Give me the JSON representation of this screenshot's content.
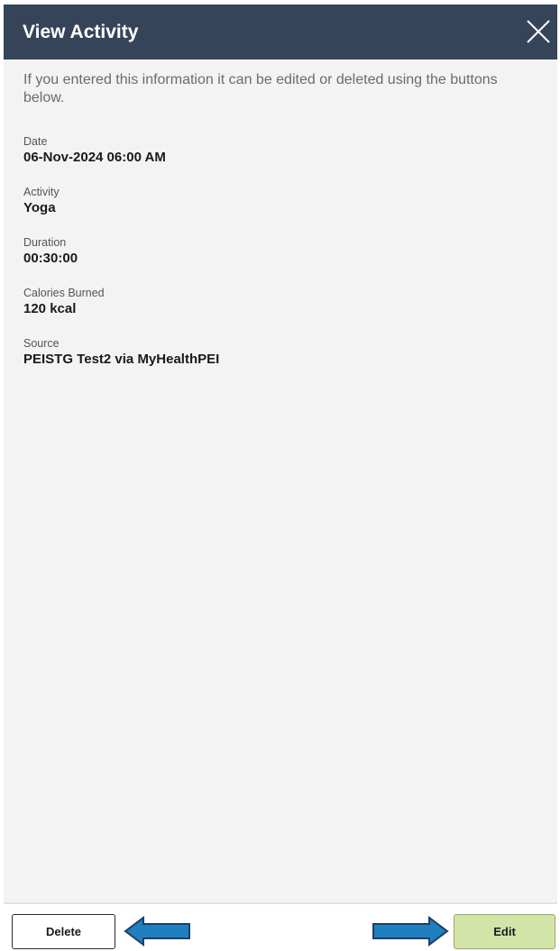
{
  "dialog": {
    "title": "View Activity",
    "close_icon": "close-x-icon",
    "intro": "If you entered this information it can be edited or deleted using the buttons below."
  },
  "fields": {
    "date": {
      "label": "Date",
      "value": "06-Nov-2024 06:00 AM"
    },
    "activity": {
      "label": "Activity",
      "value": "Yoga"
    },
    "duration": {
      "label": "Duration",
      "value": "00:30:00"
    },
    "calories": {
      "label": "Calories Burned",
      "value": "120 kcal"
    },
    "source": {
      "label": "Source",
      "value": "PEISTG Test2 via MyHealthPEI"
    }
  },
  "footer": {
    "delete_label": "Delete",
    "edit_label": "Edit"
  },
  "annotations": {
    "left_arrow_icon": "arrow-left-icon",
    "right_arrow_icon": "arrow-right-icon",
    "arrow_color": "#1f7fbf"
  },
  "colors": {
    "header_bg": "#36445a",
    "panel_bg": "#f3f3f3",
    "edit_bg": "#d3e4a9"
  }
}
